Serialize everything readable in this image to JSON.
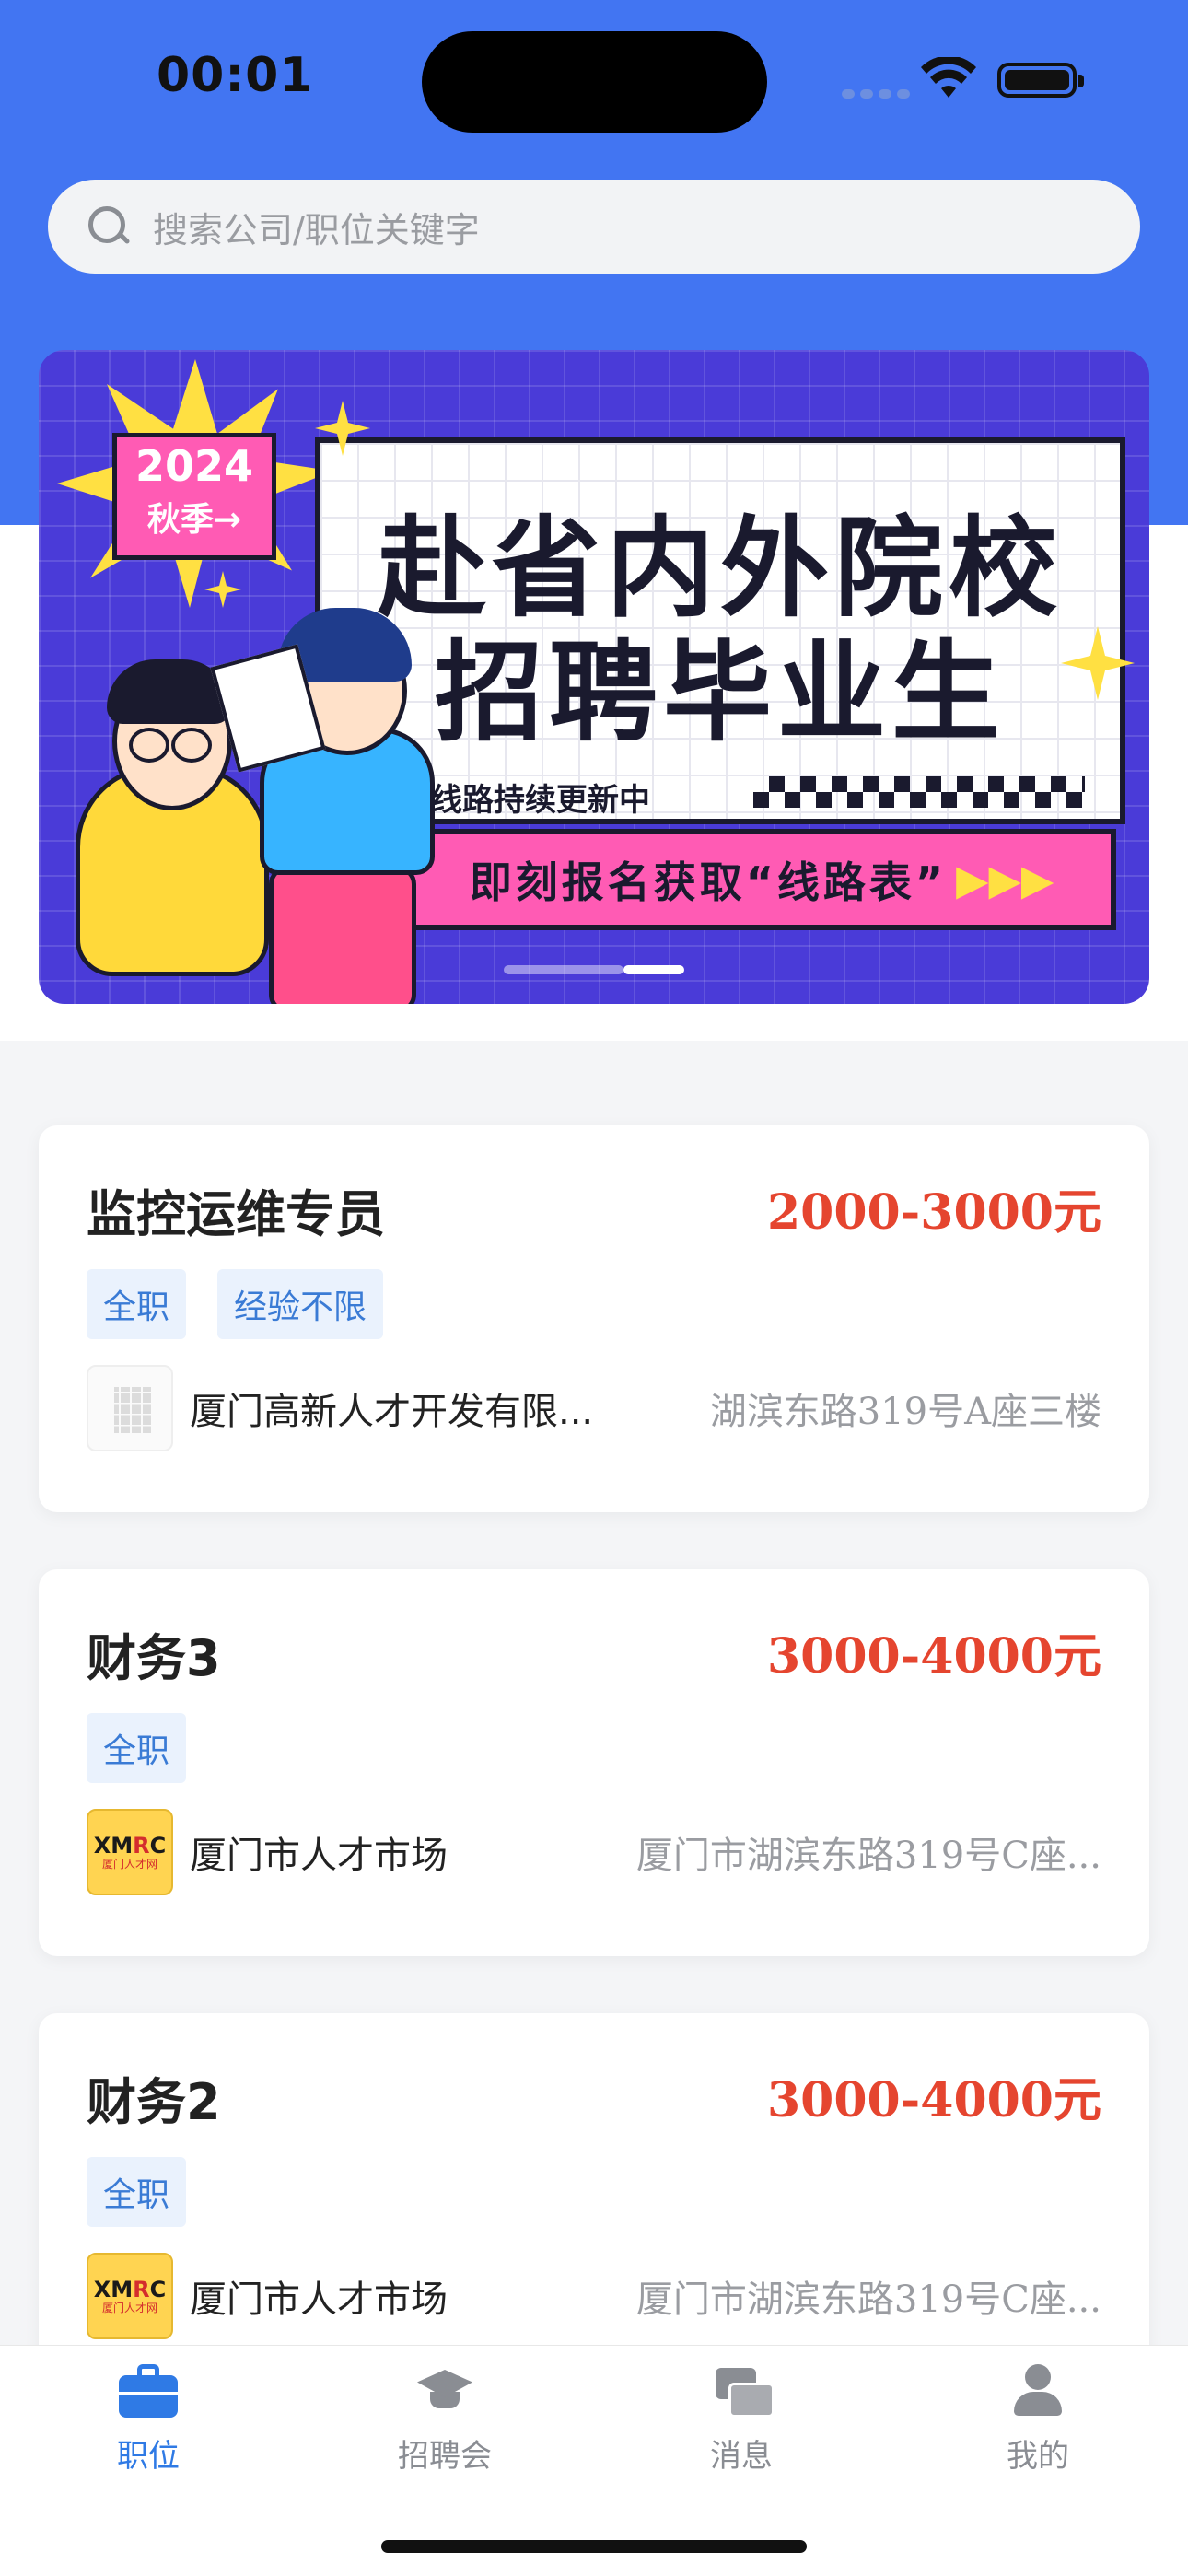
{
  "status_bar": {
    "time": "00:01"
  },
  "search": {
    "placeholder": "搜索公司/职位关键字"
  },
  "banner": {
    "year": "2024",
    "season": "秋季→",
    "headline_line1": "赴省内外院校",
    "headline_line2": "招聘毕业生",
    "subtitle": "线路持续更新中",
    "cta": "即刻报名获取“线路表”",
    "cta_arrows": "▶▶▶",
    "carousel_pages": 2,
    "carousel_active_index": 1
  },
  "jobs": [
    {
      "title": "监控运维专员",
      "salary": "2000-3000元",
      "tags": [
        "全职",
        "经验不限"
      ],
      "company": "厦门高新人才开发有限...",
      "address": "湖滨东路319号A座三楼",
      "logo": "building-icon"
    },
    {
      "title": "财务3",
      "salary": "3000-4000元",
      "tags": [
        "全职"
      ],
      "company": "厦门市人才市场",
      "address": "厦门市湖滨东路319号C座...",
      "logo": "xmrc-logo"
    },
    {
      "title": "财务2",
      "salary": "3000-4000元",
      "tags": [
        "全职"
      ],
      "company": "厦门市人才市场",
      "address": "厦门市湖滨东路319号C座...",
      "logo": "xmrc-logo"
    }
  ],
  "tabbar": {
    "items": [
      {
        "label": "职位",
        "icon": "briefcase-icon",
        "active": true
      },
      {
        "label": "招聘会",
        "icon": "graduation-cap-icon",
        "active": false
      },
      {
        "label": "消息",
        "icon": "chat-bubbles-icon",
        "active": false
      },
      {
        "label": "我的",
        "icon": "user-icon",
        "active": false
      }
    ]
  },
  "colors": {
    "header_blue": "#4275f2",
    "salary_red": "#e5452f",
    "tag_blue": "#3a7bd5",
    "tab_active": "#2f7ae5"
  }
}
